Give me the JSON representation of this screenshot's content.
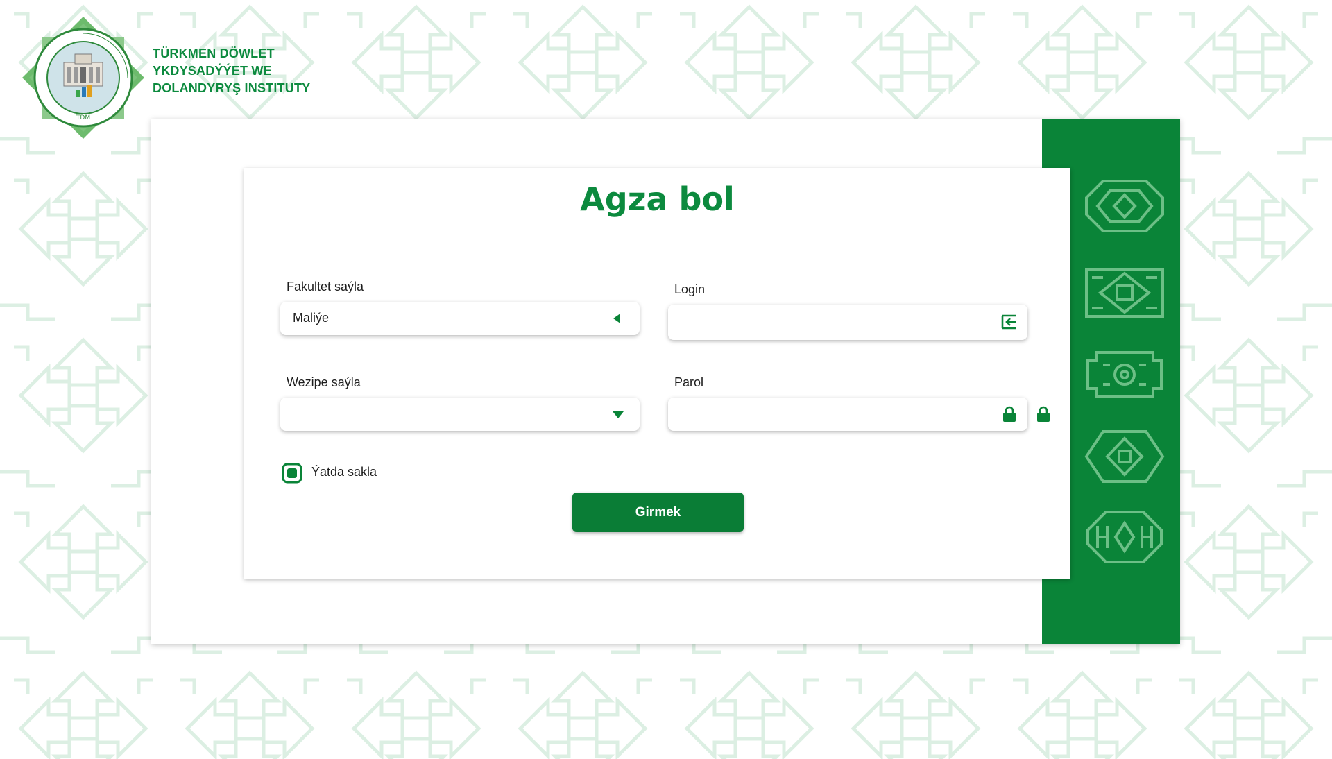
{
  "institute": {
    "name_line1": "TÜRKMEN DÖWLET",
    "name_line2": "YKDYSADÝÝET WE",
    "name_line3": "DOLANDYRYŞ INSTITUTY",
    "logo_ring_text": "TÜRKMEN DÖWLET YKDYSADÝÝET WE DOLANDYRYŞ INSTITUTY",
    "logo_badge": "TDM"
  },
  "form": {
    "title": "Agza bol",
    "faculty": {
      "label": "Fakultet saýla",
      "value": "Maliýe"
    },
    "position": {
      "label": "Wezipe saýla",
      "value": ""
    },
    "login": {
      "label": "Login",
      "value": ""
    },
    "password": {
      "label": "Parol",
      "value": ""
    },
    "remember": {
      "label": "Ýatda sakla",
      "checked": true
    },
    "submit_label": "Girmek"
  },
  "colors": {
    "accent": "#0c8a3e",
    "panel": "#0a8438",
    "button": "#0a7d36"
  },
  "icons": [
    "caret-left-icon",
    "caret-down-icon",
    "login-enter-icon",
    "lock-icon",
    "lock-toggle-icon",
    "carpet-gol-icon"
  ]
}
